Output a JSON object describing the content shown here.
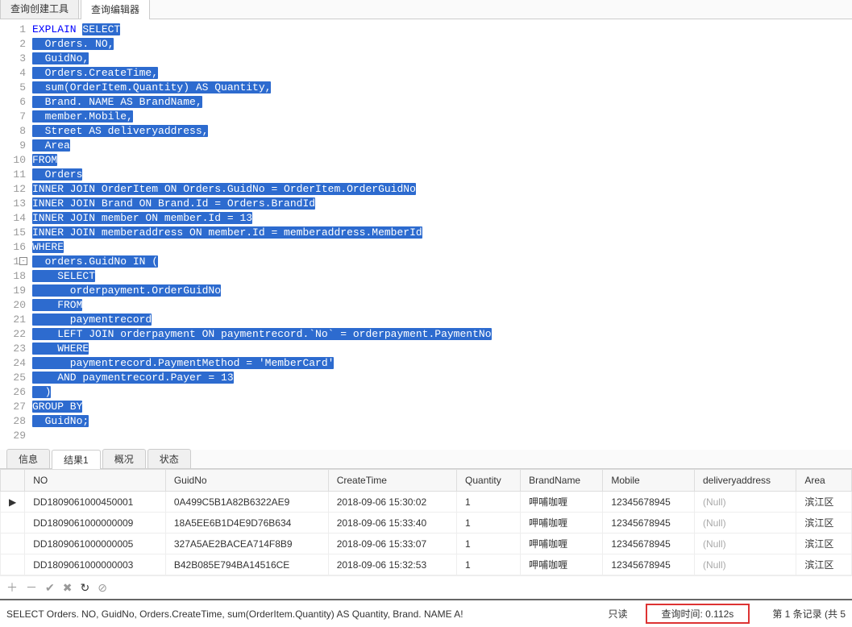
{
  "top_tabs": {
    "builder": "查询创建工具",
    "editor": "查询编辑器"
  },
  "sql": {
    "kw_explain": "EXPLAIN",
    "lines": [
      "SELECT",
      "  Orders. NO,",
      "  GuidNo,",
      "  Orders.CreateTime,",
      "  sum(OrderItem.Quantity) AS Quantity,",
      "  Brand. NAME AS BrandName,",
      "  member.Mobile,",
      "  Street AS deliveryaddress,",
      "  Area",
      "FROM",
      "  Orders",
      "INNER JOIN OrderItem ON Orders.GuidNo = OrderItem.OrderGuidNo",
      "INNER JOIN Brand ON Brand.Id = Orders.BrandId",
      "INNER JOIN member ON member.Id = 13",
      "INNER JOIN memberaddress ON member.Id = memberaddress.MemberId",
      "WHERE",
      "  orders.GuidNo IN (",
      "    SELECT",
      "      orderpayment.OrderGuidNo",
      "    FROM",
      "      paymentrecord",
      "    LEFT JOIN orderpayment ON paymentrecord.`No` = orderpayment.PaymentNo",
      "    WHERE",
      "      paymentrecord.PaymentMethod = 'MemberCard'",
      "    AND paymentrecord.Payer = 13",
      "  )",
      "GROUP BY",
      "  GuidNo;"
    ]
  },
  "result_tabs": {
    "info": "信息",
    "result1": "结果1",
    "profile": "概况",
    "status": "状态"
  },
  "columns": {
    "no": "NO",
    "guidno": "GuidNo",
    "createtime": "CreateTime",
    "quantity": "Quantity",
    "brandname": "BrandName",
    "mobile": "Mobile",
    "deliveryaddress": "deliveryaddress",
    "area": "Area"
  },
  "rows": [
    {
      "no": "DD1809061000450001",
      "guidno": "0A499C5B1A82B6322AE9",
      "createtime": "2018-09-06 15:30:02",
      "quantity": "1",
      "brandname": "呷哺咖喱",
      "mobile": "12345678945",
      "deliveryaddress": "(Null)",
      "area": "滨江区"
    },
    {
      "no": "DD1809061000000009",
      "guidno": "18A5EE6B1D4E9D76B634",
      "createtime": "2018-09-06 15:33:40",
      "quantity": "1",
      "brandname": "呷哺咖喱",
      "mobile": "12345678945",
      "deliveryaddress": "(Null)",
      "area": "滨江区"
    },
    {
      "no": "DD1809061000000005",
      "guidno": "327A5AE2BACEA714F8B9",
      "createtime": "2018-09-06 15:33:07",
      "quantity": "1",
      "brandname": "呷哺咖喱",
      "mobile": "12345678945",
      "deliveryaddress": "(Null)",
      "area": "滨江区"
    },
    {
      "no": "DD1809061000000003",
      "guidno": "B42B085E794BA14516CE",
      "createtime": "2018-09-06 15:32:53",
      "quantity": "1",
      "brandname": "呷哺咖喱",
      "mobile": "12345678945",
      "deliveryaddress": "(Null)",
      "area": "滨江区"
    }
  ],
  "status": {
    "sql": "SELECT   Orders. NO,         GuidNo,   Orders.CreateTime,               sum(OrderItem.Quantity) AS Quantity,  Brand. NAME A!",
    "readonly": "只读",
    "time": "查询时间: 0.112s",
    "record": "第 1 条记录 (共 5"
  }
}
